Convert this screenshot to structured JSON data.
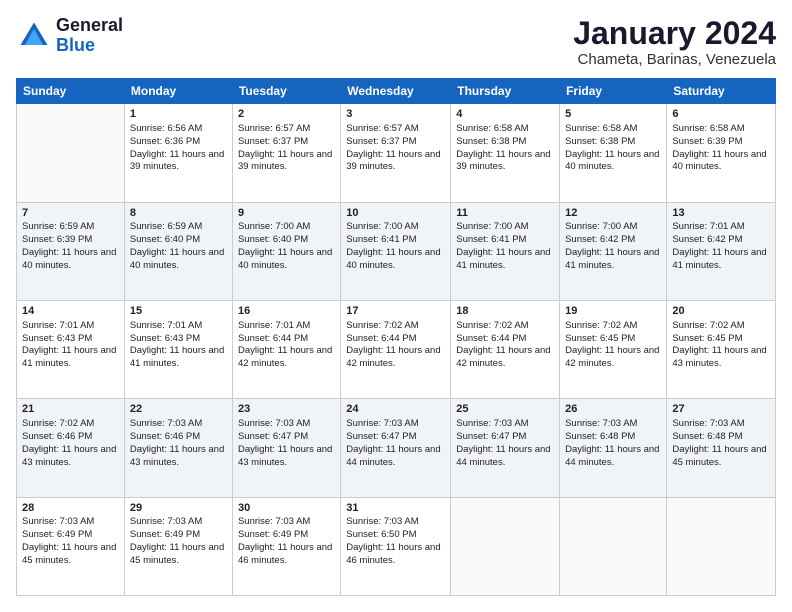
{
  "header": {
    "logo_line1": "General",
    "logo_line2": "Blue",
    "month_title": "January 2024",
    "subtitle": "Chameta, Barinas, Venezuela"
  },
  "days_of_week": [
    "Sunday",
    "Monday",
    "Tuesday",
    "Wednesday",
    "Thursday",
    "Friday",
    "Saturday"
  ],
  "weeks": [
    [
      {
        "day": "",
        "sunrise": "",
        "sunset": "",
        "daylight": ""
      },
      {
        "day": "1",
        "sunrise": "Sunrise: 6:56 AM",
        "sunset": "Sunset: 6:36 PM",
        "daylight": "Daylight: 11 hours and 39 minutes."
      },
      {
        "day": "2",
        "sunrise": "Sunrise: 6:57 AM",
        "sunset": "Sunset: 6:37 PM",
        "daylight": "Daylight: 11 hours and 39 minutes."
      },
      {
        "day": "3",
        "sunrise": "Sunrise: 6:57 AM",
        "sunset": "Sunset: 6:37 PM",
        "daylight": "Daylight: 11 hours and 39 minutes."
      },
      {
        "day": "4",
        "sunrise": "Sunrise: 6:58 AM",
        "sunset": "Sunset: 6:38 PM",
        "daylight": "Daylight: 11 hours and 39 minutes."
      },
      {
        "day": "5",
        "sunrise": "Sunrise: 6:58 AM",
        "sunset": "Sunset: 6:38 PM",
        "daylight": "Daylight: 11 hours and 40 minutes."
      },
      {
        "day": "6",
        "sunrise": "Sunrise: 6:58 AM",
        "sunset": "Sunset: 6:39 PM",
        "daylight": "Daylight: 11 hours and 40 minutes."
      }
    ],
    [
      {
        "day": "7",
        "sunrise": "Sunrise: 6:59 AM",
        "sunset": "Sunset: 6:39 PM",
        "daylight": "Daylight: 11 hours and 40 minutes."
      },
      {
        "day": "8",
        "sunrise": "Sunrise: 6:59 AM",
        "sunset": "Sunset: 6:40 PM",
        "daylight": "Daylight: 11 hours and 40 minutes."
      },
      {
        "day": "9",
        "sunrise": "Sunrise: 7:00 AM",
        "sunset": "Sunset: 6:40 PM",
        "daylight": "Daylight: 11 hours and 40 minutes."
      },
      {
        "day": "10",
        "sunrise": "Sunrise: 7:00 AM",
        "sunset": "Sunset: 6:41 PM",
        "daylight": "Daylight: 11 hours and 40 minutes."
      },
      {
        "day": "11",
        "sunrise": "Sunrise: 7:00 AM",
        "sunset": "Sunset: 6:41 PM",
        "daylight": "Daylight: 11 hours and 41 minutes."
      },
      {
        "day": "12",
        "sunrise": "Sunrise: 7:00 AM",
        "sunset": "Sunset: 6:42 PM",
        "daylight": "Daylight: 11 hours and 41 minutes."
      },
      {
        "day": "13",
        "sunrise": "Sunrise: 7:01 AM",
        "sunset": "Sunset: 6:42 PM",
        "daylight": "Daylight: 11 hours and 41 minutes."
      }
    ],
    [
      {
        "day": "14",
        "sunrise": "Sunrise: 7:01 AM",
        "sunset": "Sunset: 6:43 PM",
        "daylight": "Daylight: 11 hours and 41 minutes."
      },
      {
        "day": "15",
        "sunrise": "Sunrise: 7:01 AM",
        "sunset": "Sunset: 6:43 PM",
        "daylight": "Daylight: 11 hours and 41 minutes."
      },
      {
        "day": "16",
        "sunrise": "Sunrise: 7:01 AM",
        "sunset": "Sunset: 6:44 PM",
        "daylight": "Daylight: 11 hours and 42 minutes."
      },
      {
        "day": "17",
        "sunrise": "Sunrise: 7:02 AM",
        "sunset": "Sunset: 6:44 PM",
        "daylight": "Daylight: 11 hours and 42 minutes."
      },
      {
        "day": "18",
        "sunrise": "Sunrise: 7:02 AM",
        "sunset": "Sunset: 6:44 PM",
        "daylight": "Daylight: 11 hours and 42 minutes."
      },
      {
        "day": "19",
        "sunrise": "Sunrise: 7:02 AM",
        "sunset": "Sunset: 6:45 PM",
        "daylight": "Daylight: 11 hours and 42 minutes."
      },
      {
        "day": "20",
        "sunrise": "Sunrise: 7:02 AM",
        "sunset": "Sunset: 6:45 PM",
        "daylight": "Daylight: 11 hours and 43 minutes."
      }
    ],
    [
      {
        "day": "21",
        "sunrise": "Sunrise: 7:02 AM",
        "sunset": "Sunset: 6:46 PM",
        "daylight": "Daylight: 11 hours and 43 minutes."
      },
      {
        "day": "22",
        "sunrise": "Sunrise: 7:03 AM",
        "sunset": "Sunset: 6:46 PM",
        "daylight": "Daylight: 11 hours and 43 minutes."
      },
      {
        "day": "23",
        "sunrise": "Sunrise: 7:03 AM",
        "sunset": "Sunset: 6:47 PM",
        "daylight": "Daylight: 11 hours and 43 minutes."
      },
      {
        "day": "24",
        "sunrise": "Sunrise: 7:03 AM",
        "sunset": "Sunset: 6:47 PM",
        "daylight": "Daylight: 11 hours and 44 minutes."
      },
      {
        "day": "25",
        "sunrise": "Sunrise: 7:03 AM",
        "sunset": "Sunset: 6:47 PM",
        "daylight": "Daylight: 11 hours and 44 minutes."
      },
      {
        "day": "26",
        "sunrise": "Sunrise: 7:03 AM",
        "sunset": "Sunset: 6:48 PM",
        "daylight": "Daylight: 11 hours and 44 minutes."
      },
      {
        "day": "27",
        "sunrise": "Sunrise: 7:03 AM",
        "sunset": "Sunset: 6:48 PM",
        "daylight": "Daylight: 11 hours and 45 minutes."
      }
    ],
    [
      {
        "day": "28",
        "sunrise": "Sunrise: 7:03 AM",
        "sunset": "Sunset: 6:49 PM",
        "daylight": "Daylight: 11 hours and 45 minutes."
      },
      {
        "day": "29",
        "sunrise": "Sunrise: 7:03 AM",
        "sunset": "Sunset: 6:49 PM",
        "daylight": "Daylight: 11 hours and 45 minutes."
      },
      {
        "day": "30",
        "sunrise": "Sunrise: 7:03 AM",
        "sunset": "Sunset: 6:49 PM",
        "daylight": "Daylight: 11 hours and 46 minutes."
      },
      {
        "day": "31",
        "sunrise": "Sunrise: 7:03 AM",
        "sunset": "Sunset: 6:50 PM",
        "daylight": "Daylight: 11 hours and 46 minutes."
      },
      {
        "day": "",
        "sunrise": "",
        "sunset": "",
        "daylight": ""
      },
      {
        "day": "",
        "sunrise": "",
        "sunset": "",
        "daylight": ""
      },
      {
        "day": "",
        "sunrise": "",
        "sunset": "",
        "daylight": ""
      }
    ]
  ]
}
